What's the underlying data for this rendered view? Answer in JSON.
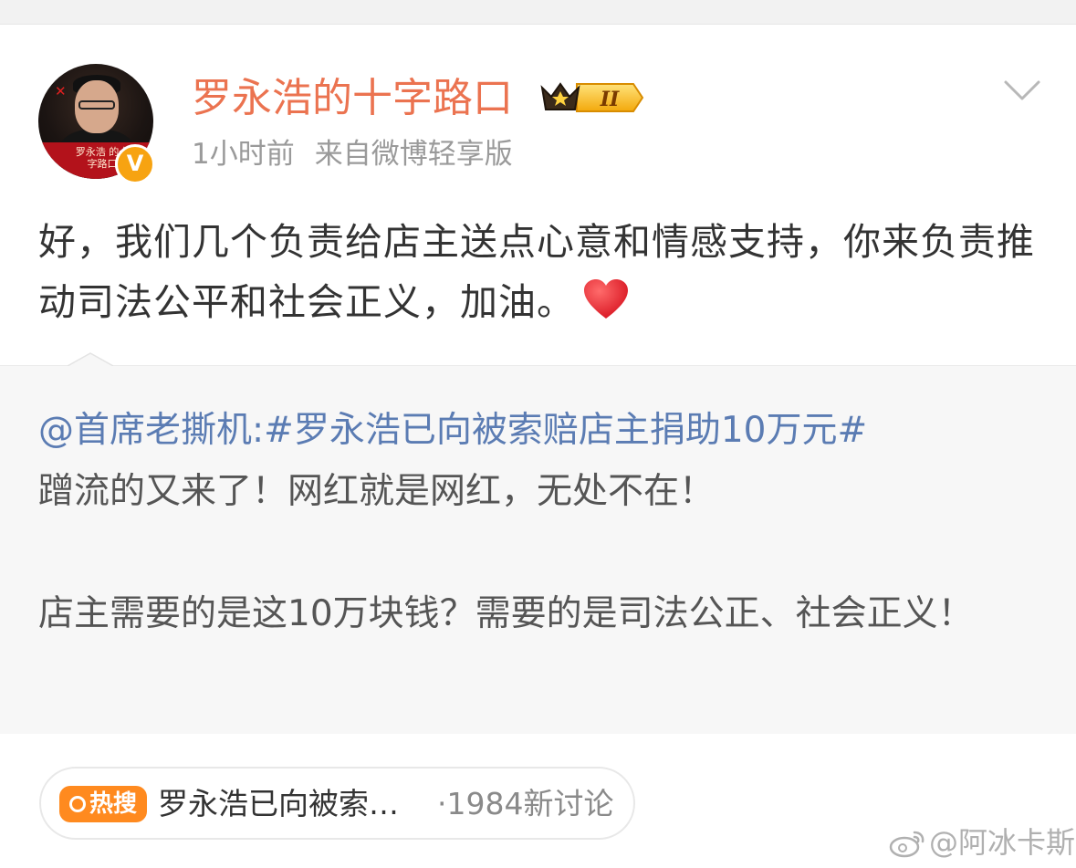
{
  "post": {
    "author": "罗永浩的十字路口",
    "avatar_caption": "罗永浩 的十字路口",
    "vip_level": "II",
    "time": "1小时前",
    "source": "来自微博轻享版",
    "text": "好，我们几个负责给店主送点心意和情感支持，你来负责推动司法公平和社会正义，加油。",
    "emoji": "heart-emoji"
  },
  "quote": {
    "mention": "@首席老撕机",
    "colon": ":",
    "hashtag": "#罗永浩已向被索赔店主捐助10万元#",
    "body": "\n蹭流的又来了！网红就是网红，无处不在！\n\n店主需要的是这10万块钱？需要的是司法公正、社会正义！"
  },
  "hot_search": {
    "tag_label": "热搜",
    "title": "罗永浩已向被索…",
    "count": "·1984新讨论"
  },
  "watermark": {
    "text": "@阿冰卡斯"
  },
  "colors": {
    "author": "#eb7350",
    "link": "#5b7cb3",
    "hot_tag": "#ff8a1f",
    "verified": "#f7a311",
    "quote_bg": "#f7f7f7"
  }
}
